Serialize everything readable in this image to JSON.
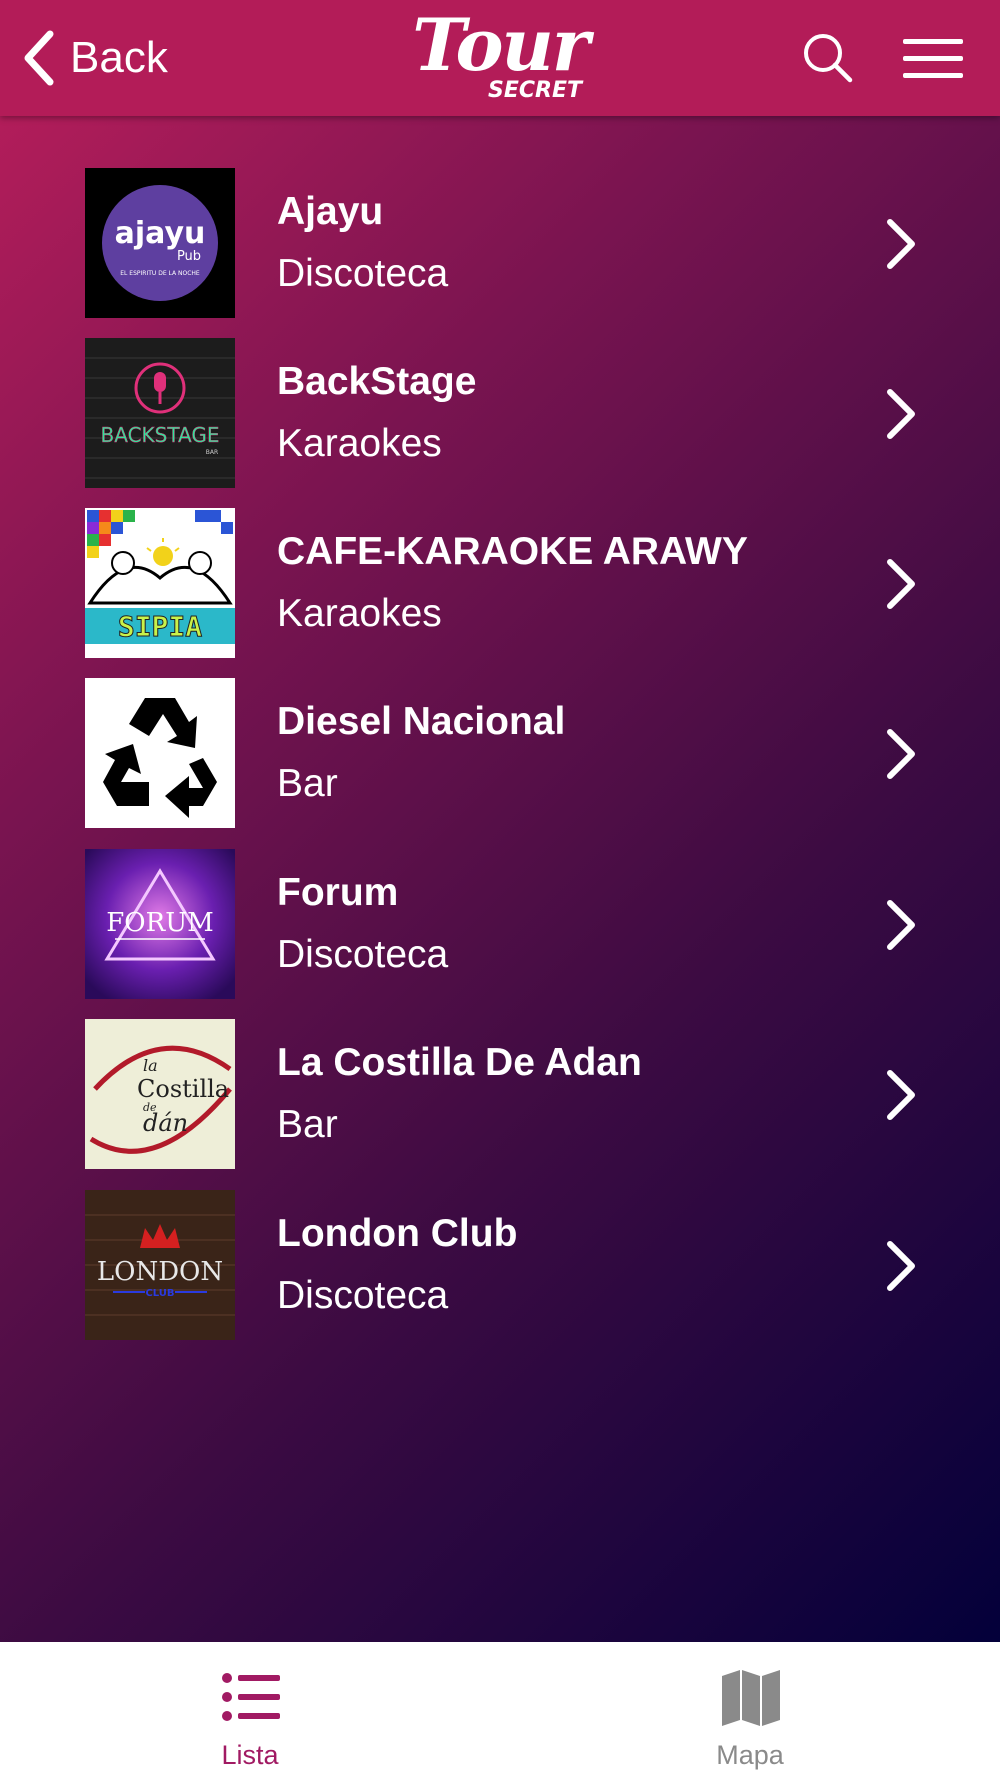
{
  "header": {
    "back_label": "Back",
    "logo_main": "Tour",
    "logo_sub": "SECRET",
    "icons": [
      "chevron-left-icon",
      "search-icon",
      "hamburger-menu-icon"
    ]
  },
  "colors": {
    "header_bg": "#b31c58",
    "gradient_start": "#b21d5a",
    "gradient_end": "#03003a",
    "tab_active": "#a11a63",
    "tab_inactive": "#8a8a8a"
  },
  "venues": [
    {
      "name": "Ajayu",
      "category": "Discoteca"
    },
    {
      "name": "BackStage",
      "category": "Karaokes"
    },
    {
      "name": "CAFE-KARAOKE ARAWY",
      "category": "Karaokes"
    },
    {
      "name": "Diesel Nacional",
      "category": "Bar"
    },
    {
      "name": "Forum",
      "category": "Discoteca"
    },
    {
      "name": "La Costilla De Adan",
      "category": "Bar"
    },
    {
      "name": "London Club",
      "category": "Discoteca"
    }
  ],
  "logos": {
    "ajayu": {
      "main": "ajayu",
      "sub": "Pub",
      "tagline": "EL ESPIRITU DE LA NOCHE"
    },
    "backstage": {
      "text": "BACKSTAGE",
      "small": "BAR"
    },
    "arawy": {
      "text": "SIPIA"
    },
    "forum": {
      "text": "FORUM"
    },
    "costilla": {
      "la": "la",
      "main": "Costilla",
      "de": "de",
      "adan": "dán"
    },
    "london": {
      "text": "LONDON",
      "small": "CLUB"
    }
  },
  "tabs": [
    {
      "label": "Lista",
      "icon": "list-icon",
      "active": true
    },
    {
      "label": "Mapa",
      "icon": "map-icon",
      "active": false
    }
  ]
}
